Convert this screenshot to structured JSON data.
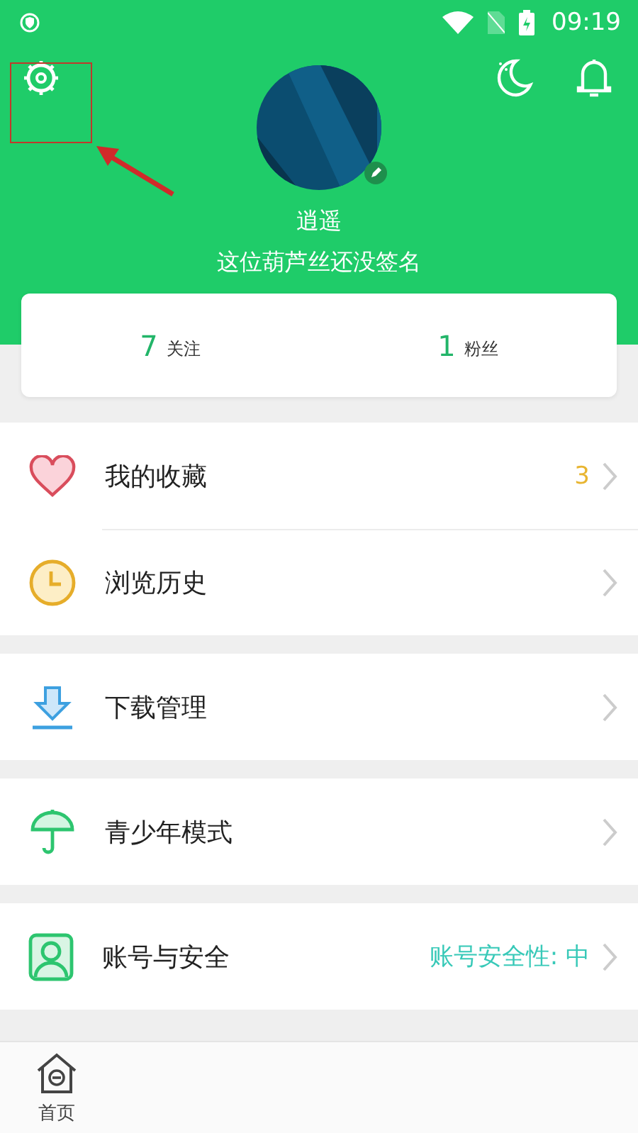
{
  "status_bar": {
    "time": "09:19"
  },
  "profile": {
    "name": "逍遥",
    "signature": "这位葫芦丝还没签名"
  },
  "stats": [
    {
      "count": "7",
      "label": "关注"
    },
    {
      "count": "1",
      "label": "粉丝"
    }
  ],
  "menu_groups": [
    [
      {
        "kind": "favorites",
        "label": "我的收藏",
        "badge": {
          "text": "3",
          "color": "#e8b531"
        }
      },
      {
        "kind": "history",
        "label": "浏览历史"
      }
    ],
    [
      {
        "kind": "download",
        "label": "下载管理"
      }
    ],
    [
      {
        "kind": "youth",
        "label": "青少年模式"
      }
    ],
    [
      {
        "kind": "account",
        "label": "账号与安全",
        "badge": {
          "text": "账号安全性: 中",
          "color": "#38c9b8"
        }
      }
    ]
  ],
  "bottom_nav": [
    {
      "label": "首页",
      "selected": false
    }
  ]
}
